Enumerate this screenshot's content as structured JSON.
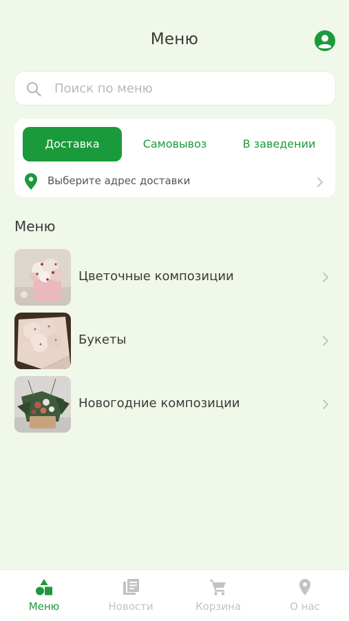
{
  "header": {
    "title": "Меню",
    "profile_icon": "account-circle-icon"
  },
  "search": {
    "placeholder": "Поиск по меню",
    "value": ""
  },
  "delivery": {
    "modes": [
      {
        "label": "Доставка",
        "active": true
      },
      {
        "label": "Самовывоз",
        "active": false
      },
      {
        "label": "В заведении",
        "active": false
      }
    ],
    "address_prompt": "Выберите адрес доставки"
  },
  "menu": {
    "section_title": "Меню",
    "categories": [
      {
        "label": "Цветочные композиции",
        "image": "flower-arrangement-photo"
      },
      {
        "label": "Букеты",
        "image": "bouquet-photo"
      },
      {
        "label": "Новогодние композиции",
        "image": "new-year-arrangement-photo"
      }
    ]
  },
  "tabbar": {
    "items": [
      {
        "label": "Меню",
        "icon": "shapes-icon",
        "active": true
      },
      {
        "label": "Новости",
        "icon": "news-icon",
        "active": false
      },
      {
        "label": "Корзина",
        "icon": "cart-icon",
        "active": false
      },
      {
        "label": "О нас",
        "icon": "location-icon",
        "active": false
      }
    ]
  },
  "colors": {
    "accent": "#1a9a3a",
    "background": "#eff8e9",
    "inactive": "#c2c2c2"
  }
}
